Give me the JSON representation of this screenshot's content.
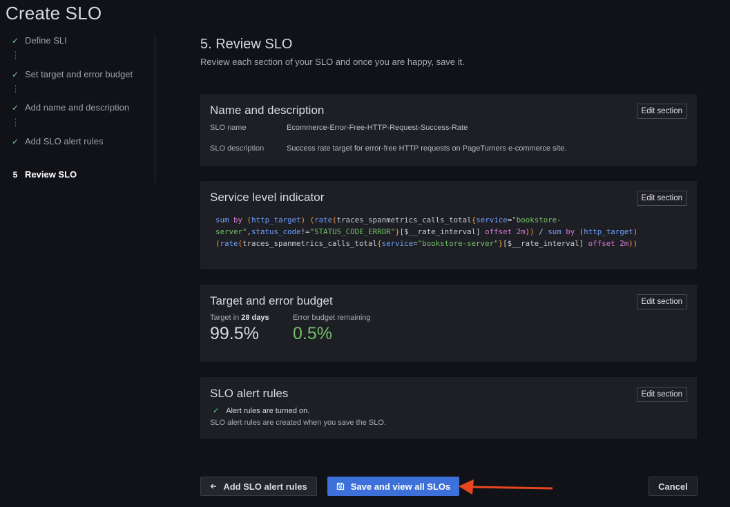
{
  "page": {
    "title": "Create SLO"
  },
  "stepper": {
    "steps": [
      {
        "mark": "✓",
        "label": "Define SLI"
      },
      {
        "mark": "✓",
        "label": "Set target and error budget"
      },
      {
        "mark": "✓",
        "label": "Add name and description"
      },
      {
        "mark": "✓",
        "label": "Add SLO alert rules"
      },
      {
        "mark": "5",
        "label": "Review SLO"
      }
    ]
  },
  "main": {
    "heading": "5. Review SLO",
    "subheading": "Review each section of your SLO and once you are happy, save it."
  },
  "name_section": {
    "title": "Name and description",
    "edit_label": "Edit section",
    "slo_name_label": "SLO name",
    "slo_name_value": "Ecommerce-Error-Free-HTTP-Request-Success-Rate",
    "slo_description_label": "SLO description",
    "slo_description_value": "Success rate target for error-free HTTP requests on PageTurners e-commerce site."
  },
  "sli_section": {
    "title": "Service level indicator",
    "edit_label": "Edit section",
    "query": {
      "sum": "sum",
      "by": "by",
      "label_http_target": "http_target",
      "rate": "rate",
      "metric": "traces_spanmetrics_calls_total",
      "label_service": "service",
      "service_value_part1": "\"bookstore-",
      "service_value_part2": "server\"",
      "label_status_code": "status_code",
      "neq": "!=",
      "status_value": "\"STATUS_CODE_ERROR\"",
      "range": "[$__rate_interval]",
      "offset": "offset",
      "offset_value": "2m",
      "service_value_full": "\"bookstore-server\""
    }
  },
  "target_section": {
    "title": "Target and error budget",
    "edit_label": "Edit section",
    "target_label_prefix": "Target in",
    "target_days": "28 days",
    "target_value": "99.5%",
    "error_budget_label": "Error budget remaining",
    "error_budget_value": "0.5%",
    "error_budget_color": "#73bf69"
  },
  "alert_section": {
    "title": "SLO alert rules",
    "edit_label": "Edit section",
    "status_text": "Alert rules are turned on.",
    "note": "SLO alert rules are created when you save the SLO."
  },
  "footer": {
    "back_label": "Add SLO alert rules",
    "save_label": "Save and view all SLOs",
    "cancel_label": "Cancel"
  },
  "colors": {
    "accent": "#3d71d9",
    "success": "#6ccf8e",
    "annotation_arrow": "#e8461f"
  }
}
